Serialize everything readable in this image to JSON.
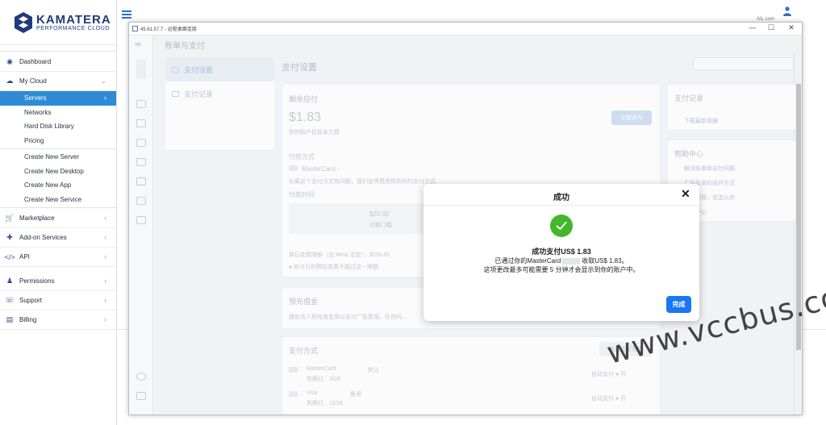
{
  "brand": {
    "name": "KAMATERA",
    "tagline": "PERFORMANCE CLOUD",
    "colors": {
      "primary": "#1f3a7a",
      "active": "#2f8bd6"
    }
  },
  "header": {
    "user_email": "AIL.com"
  },
  "sidebar": {
    "items": [
      {
        "label": "Dashboard",
        "icon": "dashboard-icon"
      },
      {
        "label": "My Cloud",
        "icon": "cloud-icon",
        "expanded": true
      },
      {
        "label": "Servers",
        "active": true
      },
      {
        "label": "Networks"
      },
      {
        "label": "Hard Disk Library"
      },
      {
        "label": "Pricing"
      },
      {
        "label": "Create New Server"
      },
      {
        "label": "Create New Desktop"
      },
      {
        "label": "Create New App"
      },
      {
        "label": "Create New Service"
      },
      {
        "label": "Marketplace",
        "icon": "cart-icon"
      },
      {
        "label": "Add-on Services",
        "icon": "addon-icon"
      },
      {
        "label": "API",
        "icon": "code-icon"
      },
      {
        "label": "Permissions",
        "icon": "users-icon"
      },
      {
        "label": "Support",
        "icon": "headset-icon"
      },
      {
        "label": "Billing",
        "icon": "card-icon"
      }
    ]
  },
  "rdp": {
    "title": "45.61.57.7 - 远程桌面连接",
    "controls": {
      "minimize": "—",
      "maximize": "☐",
      "close": "✕"
    }
  },
  "fb": {
    "header": "账单与支付",
    "nav": [
      "支付设置",
      "支付记录"
    ],
    "page_title": "支付设置",
    "balance": {
      "title": "剩余应付",
      "amount": "$1.83",
      "note": "你的账户目前未欠费",
      "pay_button": "立即支付",
      "method_label": "付款方式",
      "card": "MasterCard ·",
      "card_note": "如果这个支付方式有问题，我们会将费用转到你的支付方式",
      "time_label": "付款时间",
      "threshold": "$20.00",
      "threshold_note": "付款门槛",
      "limit": "单日花费限额（由 Meta 设定）：$250.00",
      "limit_note": "● 你今日的预估花费不超过这一限额"
    },
    "prepay": {
      "title": "预充值金",
      "text": "提前充入预充值金用以支付广告费用。在询问..."
    },
    "methods": {
      "title": "支付方式",
      "add_button": "添加支付方式",
      "rows": [
        {
          "brand": "MasterCard",
          "tag": "默认",
          "expiry": "到期日：3/28",
          "status": "自动支付 ● 开"
        },
        {
          "brand": "Visa",
          "tag": "备用",
          "expiry": "到期日：11/28",
          "status": "自动支付 ● 开"
        }
      ]
    },
    "records": {
      "title": "支付记录",
      "link": "下载最新收据"
    },
    "help": {
      "title": "帮助中心",
      "links": [
        "解决账单和支付问题",
        "广告账单的运作方式",
        "支付失败，该怎么办",
        "帮助中心"
      ]
    }
  },
  "dialog": {
    "title": "成功",
    "heading": "成功支付US$ 1.83",
    "line1_pre": "已通过你的MasterCard",
    "line1_post": "收取US$ 1.83。",
    "line2": "这项更改最多可能需要 5 分钟才会显示到你的账户中。",
    "done_button": "完成",
    "colors": {
      "check": "#42b72a",
      "button": "#1877f2"
    }
  },
  "watermark": "www.vccbus.com"
}
